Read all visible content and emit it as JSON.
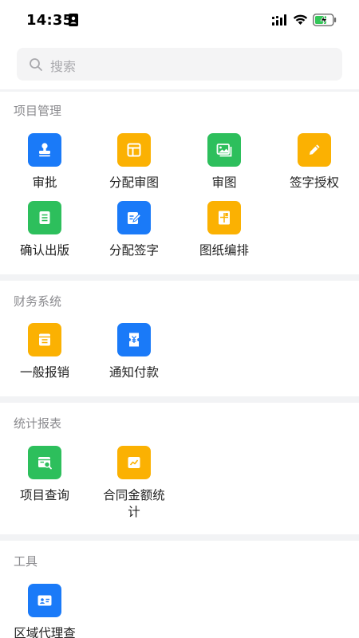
{
  "status_bar": {
    "time": "14:35"
  },
  "search": {
    "placeholder": "搜索"
  },
  "colors": {
    "blue": "#1a7af8",
    "orange": "#fbb102",
    "green": "#2dbf5c"
  },
  "sections": [
    {
      "title": "项目管理",
      "items": [
        {
          "label": "审批",
          "icon": "stamp-icon",
          "color": "blue"
        },
        {
          "label": "分配审图",
          "icon": "layout-icon",
          "color": "orange"
        },
        {
          "label": "审图",
          "icon": "image-icon",
          "color": "green"
        },
        {
          "label": "签字授权",
          "icon": "pen-icon",
          "color": "orange"
        },
        {
          "label": "确认出版",
          "icon": "list-doc-icon",
          "color": "green"
        },
        {
          "label": "分配签字",
          "icon": "sign-edit-icon",
          "color": "blue"
        },
        {
          "label": "图纸编排",
          "icon": "drawing-icon",
          "color": "orange"
        }
      ]
    },
    {
      "title": "财务系统",
      "items": [
        {
          "label": "一般报销",
          "icon": "receipt-icon",
          "color": "orange"
        },
        {
          "label": "通知付款",
          "icon": "yuan-ticket-icon",
          "color": "blue"
        }
      ]
    },
    {
      "title": "统计报表",
      "items": [
        {
          "label": "项目查询",
          "icon": "search-doc-icon",
          "color": "green"
        },
        {
          "label": "合同金额统计",
          "icon": "trend-chart-icon",
          "color": "orange"
        }
      ]
    },
    {
      "title": "工具",
      "items": [
        {
          "label": "区域代理查",
          "icon": "id-card-icon",
          "color": "blue"
        }
      ]
    }
  ]
}
